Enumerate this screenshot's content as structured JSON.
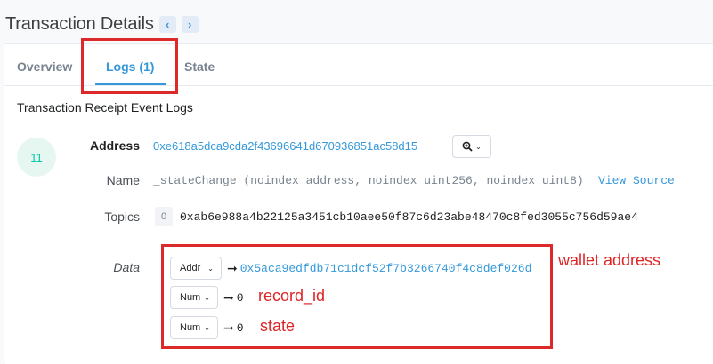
{
  "header": {
    "title": "Transaction Details",
    "prev_icon": "chevron-left-icon",
    "next_icon": "chevron-right-icon"
  },
  "tabs": [
    {
      "label": "Overview"
    },
    {
      "label": "Logs (1)",
      "active": true
    },
    {
      "label": "State"
    }
  ],
  "section_title": "Transaction Receipt Event Logs",
  "log": {
    "index": "11",
    "address_label": "Address",
    "address": "0xe618a5dca9cda2f43696641d670936851ac58d15",
    "zoom_icon": "magnifier-icon",
    "name_label": "Name",
    "event_signature": "_stateChange (noindex address, noindex uint256, noindex uint8)",
    "view_source": "View Source",
    "topics_label": "Topics",
    "topics": [
      {
        "index": "0",
        "value": "0xab6e988a4b22125a3451cb10aee50f87c6d23abe48470c8fed3055c756d59ae4"
      }
    ],
    "data_label": "Data",
    "data": [
      {
        "type": "Addr",
        "value": "0x5aca9edfdb71c1dcf52f7b3266740f4c8def026d"
      },
      {
        "type": "Num",
        "value": "0"
      },
      {
        "type": "Num",
        "value": "0"
      }
    ]
  },
  "annotations": {
    "wallet_address": "wallet address",
    "record_id": "record_id",
    "state": "state",
    "highlight_color": "#dc2a2a"
  },
  "colors": {
    "link": "#3498db",
    "accent_teal": "#00c9a7"
  }
}
